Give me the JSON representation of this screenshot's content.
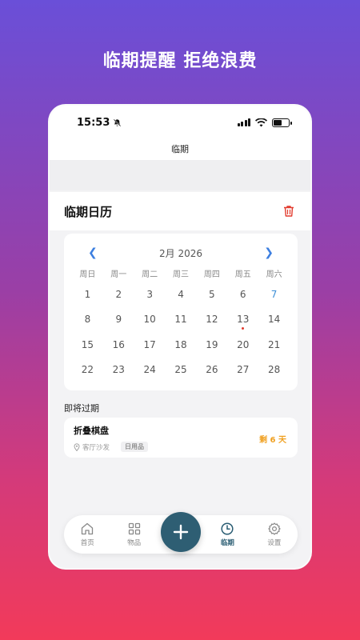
{
  "headline": "临期提醒  拒绝浪费",
  "status": {
    "time": "15:53"
  },
  "nav": {
    "title": "临期"
  },
  "calendar": {
    "title": "临期日历",
    "month_label": "2月 2026",
    "weekdays": [
      "周日",
      "周一",
      "周二",
      "周三",
      "周四",
      "周五",
      "周六"
    ],
    "weeks": [
      [
        "1",
        "2",
        "3",
        "4",
        "5",
        "6",
        "7"
      ],
      [
        "8",
        "9",
        "10",
        "11",
        "12",
        "13",
        "14"
      ],
      [
        "15",
        "16",
        "17",
        "18",
        "19",
        "20",
        "21"
      ],
      [
        "22",
        "23",
        "24",
        "25",
        "26",
        "27",
        "28"
      ]
    ]
  },
  "expiring": {
    "section_title": "即将过期",
    "items": [
      {
        "name": "折叠棋盘",
        "location": "客厅沙发",
        "category": "日用品",
        "remaining": "剩 6 天"
      }
    ]
  },
  "tabbar": {
    "home": "首页",
    "items": "物品",
    "expiry": "临期",
    "settings": "设置"
  },
  "colors": {
    "accent": "#2e5e73",
    "warning": "#f0a020",
    "danger": "#e23b2e",
    "link": "#3d7fe0"
  }
}
